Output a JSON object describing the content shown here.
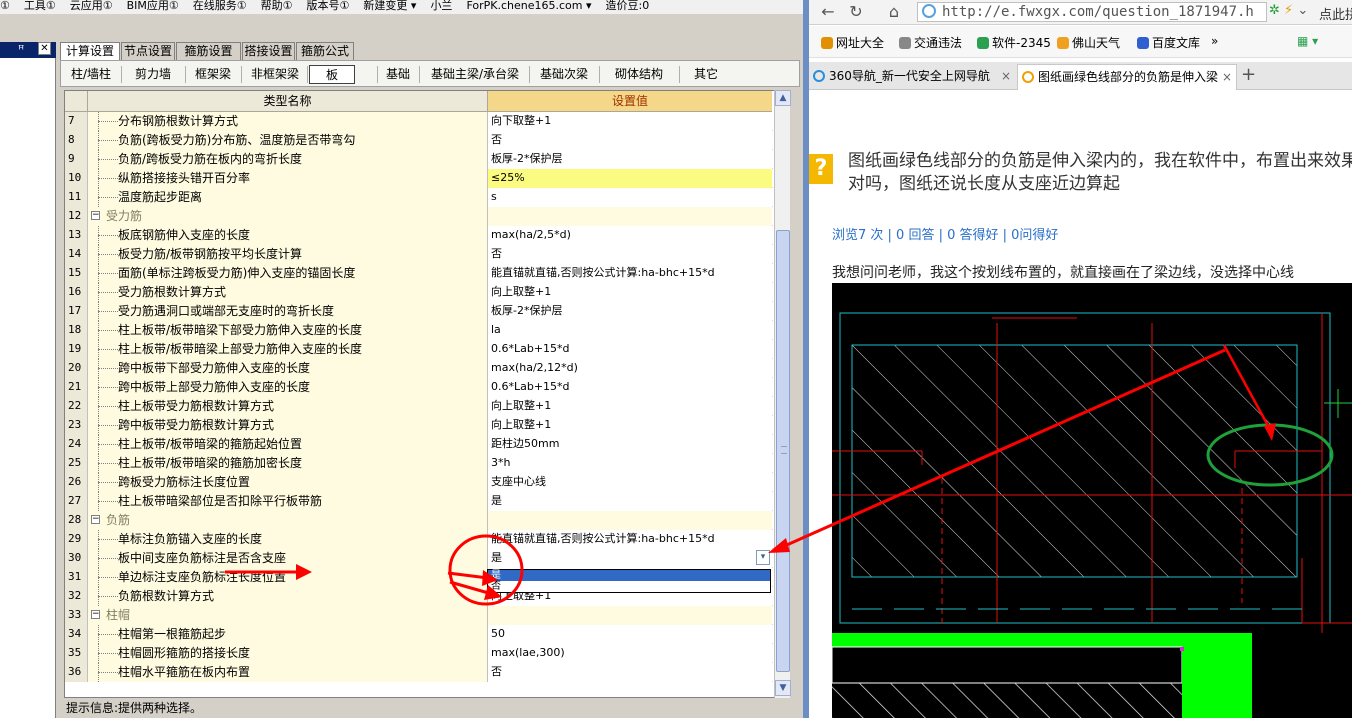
{
  "app": {
    "menubar": [
      "①",
      "工具①",
      "云应用①",
      "BIM应用①",
      "在线服务①",
      "帮助①",
      "版本号①",
      "新建变更 ▾",
      "小兰",
      "ForPK.chene165.com ▾",
      "造价豆:0"
    ],
    "top_tabs": [
      "计算设置",
      "节点设置",
      "箍筋设置",
      "搭接设置",
      "箍筋公式"
    ],
    "sub_tabs": [
      "柱/墙柱",
      "剪力墙",
      "框架梁",
      "非框架梁",
      "板",
      "基础",
      "基础主梁/承台梁",
      "基础次梁",
      "砌体结构",
      "其它"
    ],
    "active_sub_tab": "板",
    "grid": {
      "col_name": "类型名称",
      "col_value": "设置值",
      "rows": [
        {
          "num": "7",
          "name": "分布钢筋根数计算方式",
          "value": "向下取整+1"
        },
        {
          "num": "8",
          "name": "负筋(跨板受力筋)分布筋、温度筋是否带弯勾",
          "value": "否"
        },
        {
          "num": "9",
          "name": "负筋/跨板受力筋在板内的弯折长度",
          "value": "板厚-2*保护层"
        },
        {
          "num": "10",
          "name": "纵筋搭接接头错开百分率",
          "value": "≤25%",
          "highlight": true
        },
        {
          "num": "11",
          "name": "温度筋起步距离",
          "value": "s"
        },
        {
          "num": "12",
          "name": "受力筋",
          "value": "",
          "group": true
        },
        {
          "num": "13",
          "name": "板底钢筋伸入支座的长度",
          "value": "max(ha/2,5*d)"
        },
        {
          "num": "14",
          "name": "板受力筋/板带钢筋按平均长度计算",
          "value": "否"
        },
        {
          "num": "15",
          "name": "面筋(单标注跨板受力筋)伸入支座的锚固长度",
          "value": "能直锚就直锚,否则按公式计算:ha-bhc+15*d"
        },
        {
          "num": "16",
          "name": "受力筋根数计算方式",
          "value": "向上取整+1"
        },
        {
          "num": "17",
          "name": "受力筋遇洞口或端部无支座时的弯折长度",
          "value": "板厚-2*保护层"
        },
        {
          "num": "18",
          "name": "柱上板带/板带暗梁下部受力筋伸入支座的长度",
          "value": "la"
        },
        {
          "num": "19",
          "name": "柱上板带/板带暗梁上部受力筋伸入支座的长度",
          "value": "0.6*Lab+15*d"
        },
        {
          "num": "20",
          "name": "跨中板带下部受力筋伸入支座的长度",
          "value": "max(ha/2,12*d)"
        },
        {
          "num": "21",
          "name": "跨中板带上部受力筋伸入支座的长度",
          "value": "0.6*Lab+15*d"
        },
        {
          "num": "22",
          "name": "柱上板带受力筋根数计算方式",
          "value": "向上取整+1"
        },
        {
          "num": "23",
          "name": "跨中板带受力筋根数计算方式",
          "value": "向上取整+1"
        },
        {
          "num": "24",
          "name": "柱上板带/板带暗梁的箍筋起始位置",
          "value": "距柱边50mm"
        },
        {
          "num": "25",
          "name": "柱上板带/板带暗梁的箍筋加密长度",
          "value": "3*h"
        },
        {
          "num": "26",
          "name": "跨板受力筋标注长度位置",
          "value": "支座中心线"
        },
        {
          "num": "27",
          "name": "柱上板带暗梁部位是否扣除平行板带筋",
          "value": "是"
        },
        {
          "num": "28",
          "name": "负筋",
          "value": "",
          "group": true
        },
        {
          "num": "29",
          "name": "单标注负筋锚入支座的长度",
          "value": "能直锚就直锚,否则按公式计算:ha-bhc+15*d"
        },
        {
          "num": "30",
          "name": "板中间支座负筋标注是否含支座",
          "value": "是",
          "dropdown": true
        },
        {
          "num": "31",
          "name": "单边标注支座负筋标注长度位置",
          "value": "是"
        },
        {
          "num": "32",
          "name": "负筋根数计算方式",
          "value": "向上取整+1"
        },
        {
          "num": "33",
          "name": "柱帽",
          "value": "",
          "group": true
        },
        {
          "num": "34",
          "name": "柱帽第一根箍筋起步",
          "value": "50"
        },
        {
          "num": "35",
          "name": "柱帽圆形箍筋的搭接长度",
          "value": "max(lae,300)"
        },
        {
          "num": "36",
          "name": "柱帽水平箍筋在板内布置",
          "value": "否"
        }
      ]
    },
    "dropdown_options": [
      "是",
      "否"
    ],
    "status_text": "提示信息:提供两种选择。",
    "nav_close": "✕",
    "nav_pin": "ꟸ"
  },
  "browser": {
    "url": "http://e.fwxgx.com/question_1871947.h",
    "url_right": "点此拼",
    "bookmarks": [
      "网址大全",
      "交通违法",
      "软件-2345",
      "佛山天气",
      "百度文库"
    ],
    "tabs": [
      {
        "label": "360导航_新一代安全上网导航",
        "active": false
      },
      {
        "label": "图纸画绿色线部分的负筋是伸入梁",
        "active": true
      }
    ],
    "question": {
      "icon": "?",
      "title": "图纸画绿色线部分的负筋是伸入梁内的，我在软件中，布置出来效果对吗，图纸还说长度从支座近边算起",
      "stats": "浏览7 次 | 0 回答 | 0 答得好 | 0问得好",
      "body": "我想问问老师，我这个按划线布置的，就直接画在了梁边线，没选择中心线"
    }
  },
  "colors": {
    "header_value_bg": "#f5d78a",
    "highlight_cell": "#fbfb82",
    "selection": "#316ac5",
    "annotation_red": "#ff0000",
    "annotation_green": "#1fa03a",
    "cad_green": "#00ff00",
    "link_blue": "#2a6fc9"
  }
}
